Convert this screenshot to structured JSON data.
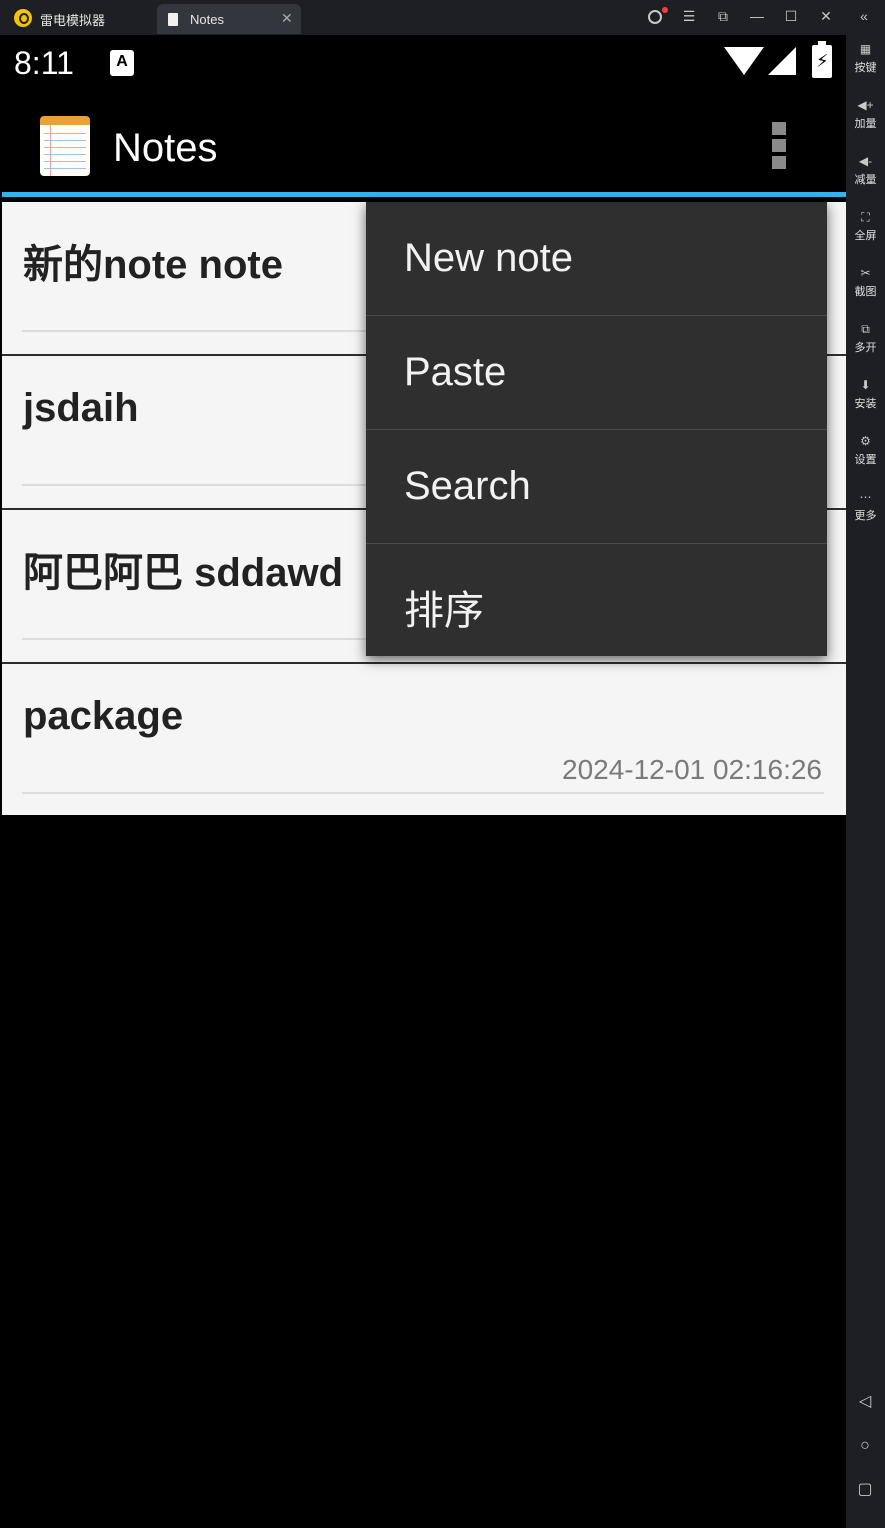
{
  "emulator": {
    "app_name": "雷电模拟器",
    "tab_title": "Notes",
    "tab_close": "✕",
    "window_buttons": [
      "☰",
      "⧉",
      "—",
      "☐",
      "✕",
      "«"
    ],
    "sidebar": [
      {
        "icon": "keyboard-icon",
        "glyph": "▦",
        "label": "按键"
      },
      {
        "icon": "volume-up-icon",
        "glyph": "◀+",
        "label": "加量"
      },
      {
        "icon": "volume-down-icon",
        "glyph": "◀-",
        "label": "减量"
      },
      {
        "icon": "fullscreen-icon",
        "glyph": "⛶",
        "label": "全屏"
      },
      {
        "icon": "screenshot-icon",
        "glyph": "✂",
        "label": "截图"
      },
      {
        "icon": "multi-instance-icon",
        "glyph": "⧉",
        "label": "多开"
      },
      {
        "icon": "apk-install-icon",
        "glyph": "⬇",
        "label": "安装"
      },
      {
        "icon": "settings-icon",
        "glyph": "⚙",
        "label": "设置"
      },
      {
        "icon": "more-icon",
        "glyph": "⋯",
        "label": "更多"
      }
    ],
    "nav": {
      "back": "◁",
      "home": "○",
      "recents": "▢"
    }
  },
  "status_bar": {
    "time": "8:11",
    "notification_icon": "A",
    "icons": [
      "wifi-icon",
      "signal-icon",
      "battery-charging-icon"
    ]
  },
  "action_bar": {
    "title": "Notes",
    "app_icon": "notepad-icon",
    "overflow_icon": "overflow-menu-icon"
  },
  "notes": [
    {
      "title": "新的note note",
      "date": ""
    },
    {
      "title": "jsdaih",
      "date": ""
    },
    {
      "title": "阿巴阿巴 sddawd",
      "date": ""
    },
    {
      "title": "package",
      "date": "2024-12-01 02:16:26"
    }
  ],
  "menu": {
    "items": [
      "New note",
      "Paste",
      "Search",
      "排序"
    ]
  },
  "colors": {
    "accent": "#34b5e5",
    "menu_background": "#2f2f2f",
    "list_background": "#f5f5f5"
  }
}
